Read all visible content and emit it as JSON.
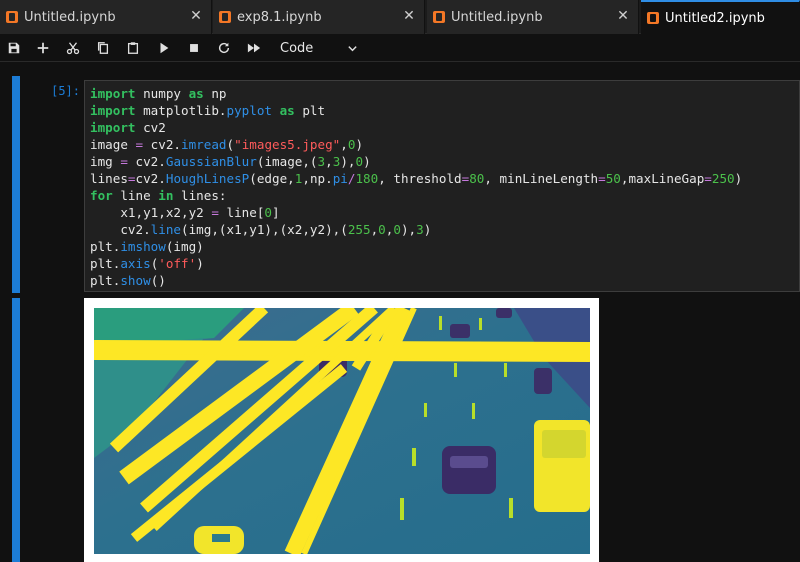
{
  "tabs": [
    {
      "label": "Untitled.ipynb",
      "active": false
    },
    {
      "label": "exp8.1.ipynb",
      "active": false
    },
    {
      "label": "Untitled.ipynb",
      "active": false
    },
    {
      "label": "Untitled2.ipynb",
      "active": true
    }
  ],
  "toolbar": {
    "icons": [
      "save-icon",
      "add-icon",
      "cut-icon",
      "copy-icon",
      "paste-icon",
      "run-icon",
      "stop-icon",
      "restart-icon",
      "fast-forward-icon"
    ],
    "cell_type": "Code"
  },
  "cell": {
    "prompt": "[5]:",
    "lines": [
      [
        [
          "kw",
          "import"
        ],
        [
          "t",
          " numpy "
        ],
        [
          "kw",
          "as"
        ],
        [
          "t",
          " np"
        ]
      ],
      [
        [
          "kw",
          "import"
        ],
        [
          "t",
          " matplotlib."
        ],
        [
          "fn",
          "pyplot"
        ],
        [
          "t",
          " "
        ],
        [
          "kw",
          "as"
        ],
        [
          "t",
          " plt"
        ]
      ],
      [
        [
          "kw",
          "import"
        ],
        [
          "t",
          " cv2"
        ]
      ],
      [
        [
          "t",
          "image "
        ],
        [
          "op",
          "="
        ],
        [
          "t",
          " cv2."
        ],
        [
          "fn",
          "imread"
        ],
        [
          "t",
          "("
        ],
        [
          "str",
          "\"images5.jpeg\""
        ],
        [
          "t",
          ","
        ],
        [
          "num",
          "0"
        ],
        [
          "t",
          ")"
        ]
      ],
      [
        [
          "t",
          "img "
        ],
        [
          "op",
          "="
        ],
        [
          "t",
          " cv2."
        ],
        [
          "fn",
          "GaussianBlur"
        ],
        [
          "t",
          "(image,("
        ],
        [
          "num",
          "3"
        ],
        [
          "t",
          ","
        ],
        [
          "num",
          "3"
        ],
        [
          "t",
          "),"
        ],
        [
          "num",
          "0"
        ],
        [
          "t",
          ")"
        ]
      ],
      [
        [
          "t",
          "lines"
        ],
        [
          "op",
          "="
        ],
        [
          "t",
          "cv2."
        ],
        [
          "fn",
          "HoughLinesP"
        ],
        [
          "t",
          "(edge,"
        ],
        [
          "num",
          "1"
        ],
        [
          "t",
          ",np."
        ],
        [
          "fn",
          "pi"
        ],
        [
          "op",
          "/"
        ],
        [
          "num",
          "180"
        ],
        [
          "t",
          ", threshold"
        ],
        [
          "op",
          "="
        ],
        [
          "num",
          "80"
        ],
        [
          "t",
          ", minLineLength"
        ],
        [
          "op",
          "="
        ],
        [
          "num",
          "50"
        ],
        [
          "t",
          ",maxLineGap"
        ],
        [
          "op",
          "="
        ],
        [
          "num",
          "250"
        ],
        [
          "t",
          ")"
        ]
      ],
      [
        [
          "kw",
          "for"
        ],
        [
          "t",
          " line "
        ],
        [
          "kw",
          "in"
        ],
        [
          "t",
          " lines:"
        ]
      ],
      [
        [
          "t",
          "    x1,y1,x2,y2 "
        ],
        [
          "op",
          "="
        ],
        [
          "t",
          " line["
        ],
        [
          "num",
          "0"
        ],
        [
          "t",
          "]"
        ]
      ],
      [
        [
          "t",
          "    cv2."
        ],
        [
          "fn",
          "line"
        ],
        [
          "t",
          "(img,(x1,y1),(x2,y2),("
        ],
        [
          "num",
          "255"
        ],
        [
          "t",
          ","
        ],
        [
          "num",
          "0"
        ],
        [
          "t",
          ","
        ],
        [
          "num",
          "0"
        ],
        [
          "t",
          "),"
        ],
        [
          "num",
          "3"
        ],
        [
          "t",
          ")"
        ]
      ],
      [
        [
          "t",
          "plt."
        ],
        [
          "fn",
          "imshow"
        ],
        [
          "t",
          "(img)"
        ]
      ],
      [
        [
          "t",
          "plt."
        ],
        [
          "fn",
          "axis"
        ],
        [
          "t",
          "("
        ],
        [
          "str",
          "'off'"
        ],
        [
          "t",
          ")"
        ]
      ],
      [
        [
          "t",
          "plt."
        ],
        [
          "fn",
          "show"
        ],
        [
          "t",
          "()"
        ]
      ]
    ]
  },
  "colors": {
    "accent": "#1c7cd5",
    "viridis_dark": "#3b4f8a",
    "viridis_mid": "#2a788e",
    "viridis_light": "#22a884",
    "line_yellow": "#fde725"
  }
}
